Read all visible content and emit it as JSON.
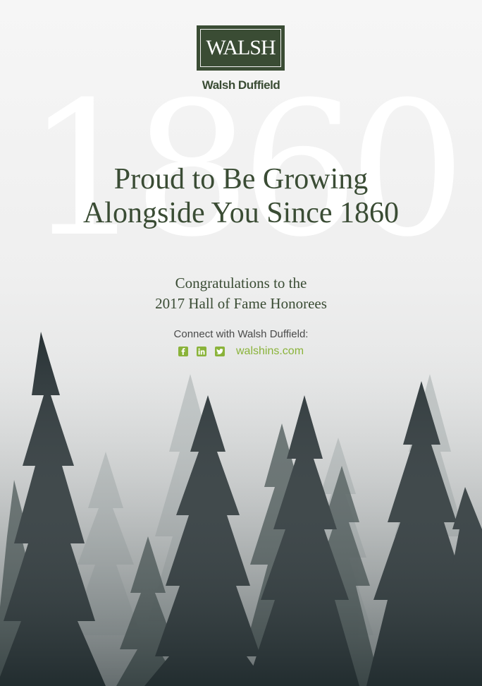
{
  "logo": {
    "wordmark": "WALSH",
    "name": "Walsh Duffield"
  },
  "hero": {
    "year": "1860",
    "headline_line1": "Proud to Be Growing",
    "headline_line2": "Alongside You Since 1860"
  },
  "subhead": {
    "line1": "Congratulations to the",
    "line2": "2017 Hall of Fame Honorees"
  },
  "connect": {
    "label": "Connect with Walsh Duffield:",
    "icons": [
      "facebook-icon",
      "linkedin-icon",
      "twitter-icon"
    ],
    "website": "walshins.com"
  },
  "colors": {
    "brand_green": "#3a4c34",
    "accent_green": "#8ab33a"
  }
}
